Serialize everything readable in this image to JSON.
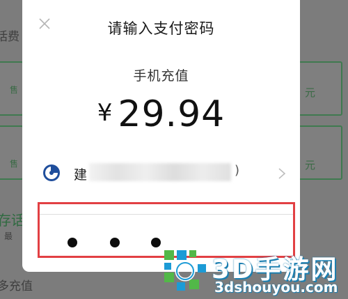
{
  "background": {
    "top_text": "话费",
    "bottom_text": "多充值",
    "card_left_1": "售",
    "card_left_2": "售",
    "card_right_1": "元",
    "card_right_2": "元",
    "left_text_3": "存话",
    "left_text_3b": "最"
  },
  "modal": {
    "title": "请输入支付密码",
    "close_icon": "close-icon",
    "subtitle": "手机充值",
    "currency": "¥",
    "amount": "29.94",
    "payment_method": {
      "bank_icon": "bank-logo-icon",
      "label": "建",
      "suffix": ")",
      "chevron_icon": "chevron-right-icon"
    },
    "password": {
      "entered_count": 3,
      "dot": "●"
    }
  },
  "watermark": {
    "title": "3D手游网",
    "url": "3dshouyou.com"
  },
  "colors": {
    "highlight_border": "#e24043",
    "watermark_blue": "#1c7fb0",
    "watermark_green": "#52b848"
  }
}
